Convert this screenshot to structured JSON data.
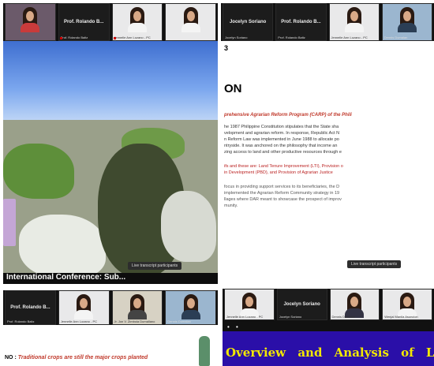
{
  "colors": {
    "strip": "#111111",
    "accent_red": "#c0392b",
    "sky": "#3f6fd0",
    "overview_bg": "#2a0fa8",
    "overview_text": "#f2e800"
  },
  "panels": {
    "top_left": {
      "participants": [
        {
          "name": "",
          "kind": "video"
        },
        {
          "name": "Prof. Rolando B...",
          "caption": "Prof. Rolando Baltz",
          "kind": "name"
        },
        {
          "name": "",
          "caption": "Jennelle Ann Lozano - PC",
          "kind": "video"
        },
        {
          "name": "",
          "caption": "",
          "kind": "video"
        }
      ],
      "slide_title": "International Conference: Sub...",
      "transcript": "Live transcript participants"
    },
    "top_right": {
      "participants": [
        {
          "name": "Jocelyn Soriano",
          "caption": "Jocelyn Soriano",
          "kind": "name"
        },
        {
          "name": "Prof. Rolando B...",
          "caption": "Prof. Rolando Baltz",
          "kind": "name"
        },
        {
          "name": "",
          "caption": "Jennelle Ann Lozano - PC",
          "kind": "video"
        },
        {
          "name": "",
          "caption": "Dennis Dumalan",
          "kind": "video"
        }
      ],
      "slide": {
        "top_letter": "3",
        "heading": "ON",
        "program": "prehensive Agrarian Reform Program (CARP) of the Phili",
        "lines": [
          "he 1987 Philippine Constitution stipulates that the State sha",
          "velopment and agrarian reform. In response, Republic Act N",
          "n Reform Law was implemented in June 1988 to allocate po",
          "ntryside. It was anchored on the philosophy that income an",
          "zing access to land and other productive resources through e"
        ],
        "red_lines": [
          "ifs and these are: Land Tenure Improvement (LTI), Provision o",
          "in Development (PBD), and Provision of Agrarian Justice"
        ],
        "more_lines": [
          "focus in providing support services to its beneficiaries, the D",
          "implemented the Agrarian Reform Community strategy in 19",
          "llages where DAR meant to showcase the prospect of improv",
          "munity."
        ]
      },
      "transcript": "Live transcript participants"
    },
    "bottom_left": {
      "participants": [
        {
          "name": "Prof. Rolando B...",
          "caption": "Prof. Rolando Baltz",
          "kind": "name"
        },
        {
          "name": "",
          "caption": "Jennelle Ann Lozano - PC",
          "kind": "video"
        },
        {
          "name": "",
          "caption": "Jr. Jon V. Zimbola Dumaliano",
          "kind": "video"
        },
        {
          "name": "",
          "caption": "Dennis Dumalan",
          "kind": "video"
        }
      ],
      "slide_text_prefix": "NO :",
      "slide_text": "Traditional crops are still the major crops planted"
    },
    "bottom_right": {
      "participants": [
        {
          "name": "",
          "caption": "Jennelle Ann Lozano - PC",
          "kind": "video"
        },
        {
          "name": "Jocelyn Soriano",
          "caption": "Jocelyn Soriano",
          "kind": "name"
        },
        {
          "name": "",
          "caption": "Dennis Dumalan",
          "kind": "video"
        },
        {
          "name": "",
          "caption": "Wenjal Manila Asuncion",
          "kind": "video"
        }
      ],
      "slide_title": "Overview and Analysis of Lan"
    }
  }
}
